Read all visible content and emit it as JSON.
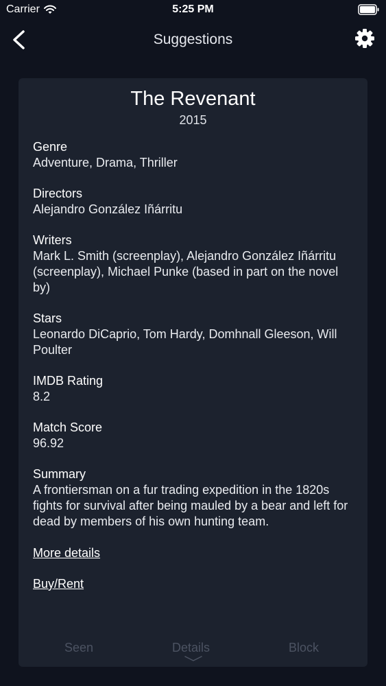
{
  "status_bar": {
    "carrier": "Carrier",
    "time": "5:25 PM"
  },
  "nav": {
    "title": "Suggestions",
    "back_icon": "chevron-left-icon",
    "settings_icon": "gear-icon"
  },
  "movie": {
    "title": "The Revenant",
    "year": "2015",
    "fields": [
      {
        "label": "Genre",
        "value": "Adventure, Drama, Thriller"
      },
      {
        "label": "Directors",
        "value": "Alejandro González Iñárritu"
      },
      {
        "label": "Writers",
        "value": "Mark L. Smith (screenplay), Alejandro González Iñárritu (screenplay), Michael Punke (based in part on the novel by)"
      },
      {
        "label": "Stars",
        "value": "Leonardo DiCaprio, Tom Hardy, Domhnall Gleeson, Will Poulter"
      },
      {
        "label": "IMDB Rating",
        "value": "8.2"
      },
      {
        "label": "Match Score",
        "value": "96.92"
      },
      {
        "label": "Summary",
        "value": "A frontiersman on a fur trading expedition in the 1820s fights for survival after being mauled by a bear and left for dead by members of his own hunting team."
      }
    ],
    "more_details": "More details",
    "buy_rent": "Buy/Rent"
  },
  "tabs": {
    "seen": "Seen",
    "details": "Details",
    "block": "Block"
  },
  "colors": {
    "background": "#0f131e",
    "card": "#1c222e",
    "inactive_tab": "#4c5362"
  }
}
